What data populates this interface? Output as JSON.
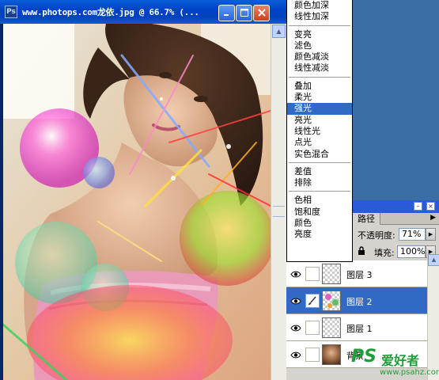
{
  "document": {
    "app_icon": "Ps",
    "title": "www.photops.com龙依.jpg @ 66.7% (...",
    "minimize_icon": "minimize-icon",
    "maximize_icon": "maximize-icon",
    "close_icon": "close-icon"
  },
  "blend_modes": {
    "groups": [
      [
        "颜色加深",
        "线性加深"
      ],
      [
        "变亮",
        "滤色",
        "颜色减淡",
        "线性减淡"
      ],
      [
        "叠加",
        "柔光",
        "强光",
        "亮光",
        "线性光",
        "点光",
        "实色混合"
      ],
      [
        "差值",
        "排除"
      ],
      [
        "色相",
        "饱和度",
        "颜色",
        "亮度"
      ]
    ],
    "selected": "强光"
  },
  "layers_panel": {
    "tab_label": "路径",
    "opacity_label": "不透明度:",
    "opacity_value": "71%",
    "fill_label": "填充:",
    "fill_value": "100%",
    "layers": [
      {
        "name": "图层 3",
        "visible": true,
        "active": false,
        "brush": false
      },
      {
        "name": "图层 2",
        "visible": true,
        "active": true,
        "brush": true
      },
      {
        "name": "图层 1",
        "visible": true,
        "active": false,
        "brush": false
      },
      {
        "name": "背景",
        "visible": true,
        "active": false,
        "brush": false,
        "photo": true
      }
    ]
  },
  "watermark": {
    "logo": "PS",
    "name": "爱好者",
    "url": "www.psahz.com"
  },
  "colors": {
    "selection": "#316ac5",
    "titlebar": "#0043c7",
    "watermark": "#1e9d38"
  }
}
